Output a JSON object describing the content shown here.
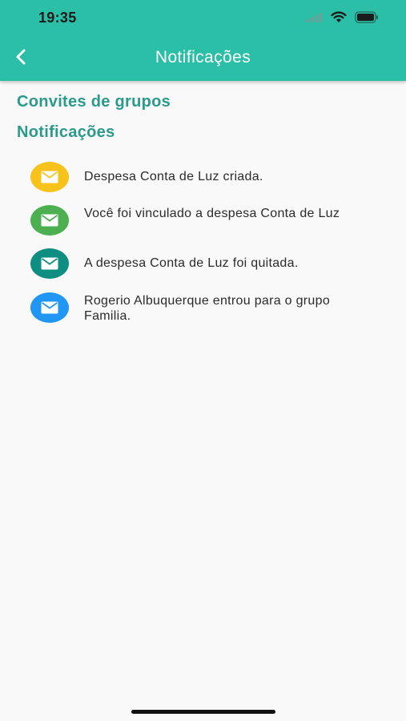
{
  "status_bar": {
    "time": "19:35"
  },
  "header": {
    "title": "Notificações",
    "back_icon": "chevron-left-icon"
  },
  "sections": {
    "invites_title": "Convites de grupos",
    "notifications_title": "Notificações"
  },
  "notifications": [
    {
      "text": "Despesa Conta de Luz criada.",
      "icon": "envelope-icon",
      "color": "#f7c21a"
    },
    {
      "text": "Você foi vinculado a despesa Conta de Luz",
      "icon": "envelope-icon",
      "color": "#4caf50"
    },
    {
      "text": "A despesa Conta de Luz foi quitada.",
      "icon": "envelope-icon",
      "color": "#0e8e80"
    },
    {
      "text": "Rogerio Albuquerque entrou para o grupo Familia.",
      "icon": "envelope-icon",
      "color": "#2196f3"
    }
  ],
  "colors": {
    "app_bar": "#2bbfa8",
    "section_title": "#2a9a8a",
    "background": "#f9f9f9"
  }
}
